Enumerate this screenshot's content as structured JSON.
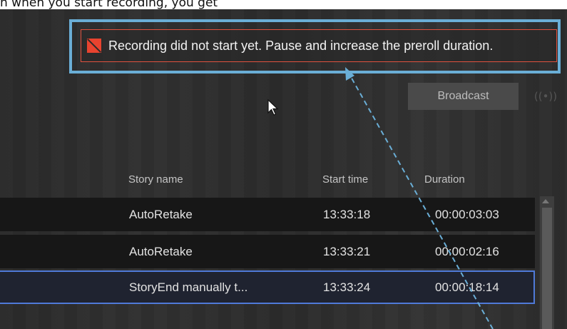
{
  "caption": "n when you start recording, you get",
  "error": {
    "message": "Recording did not start yet. Pause and increase the preroll duration.",
    "icon": "error-flag-icon",
    "color": "#e8432f"
  },
  "toolbar": {
    "broadcast_label": "Broadcast",
    "broadcast_status_icon": "broadcast-signal-icon",
    "broadcast_status_glyph": "((•))"
  },
  "table": {
    "headers": [
      "Story name",
      "Start time",
      "Duration"
    ],
    "rows": [
      {
        "story": "AutoRetake",
        "start": "13:33:18",
        "duration": "00:00:03:03"
      },
      {
        "story": "AutoRetake",
        "start": "13:33:21",
        "duration": "00:00:02:16"
      },
      {
        "story": "StoryEnd manually t...",
        "start": "13:33:24",
        "duration": "00:00:18:14"
      }
    ]
  },
  "colors": {
    "callout": "#6aaed6",
    "selection": "#4f7ad8"
  }
}
